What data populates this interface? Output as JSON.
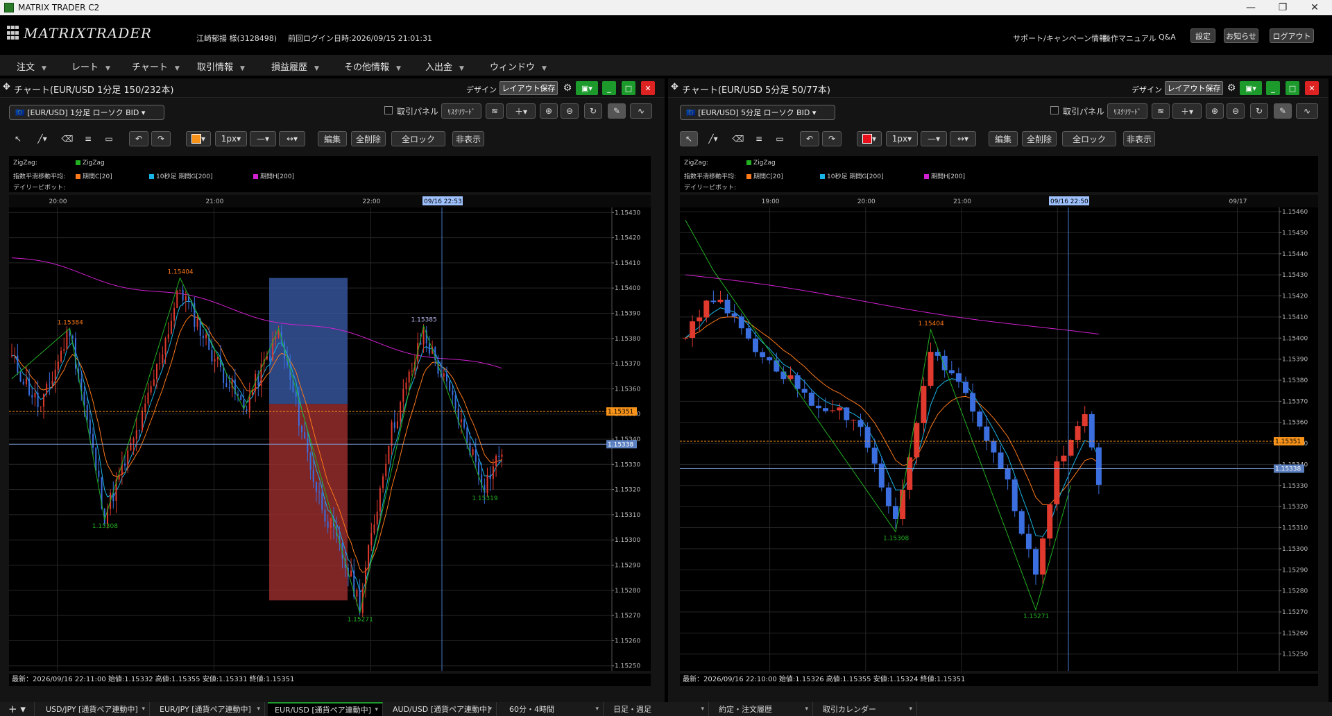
{
  "window": {
    "title": "MATRIX TRADER C2"
  },
  "header": {
    "logo": "MATRIXTRADER",
    "user": "江崎郁揚 様(3128498)",
    "last_login": "前回ログイン日時:2026/09/15 21:01:31",
    "support": "サポート/キャンペーン情報",
    "manual": "操作マニュアル",
    "qa": "Q&A",
    "settings": "設定",
    "notice": "お知らせ",
    "logout": "ログアウト"
  },
  "menu": [
    "注文",
    "レート",
    "チャート",
    "取引情報",
    "損益履歴",
    "その他情報",
    "入出金",
    "ウィンドウ"
  ],
  "colors": {
    "bull": "#e03a2e",
    "bear": "#3b6fe0",
    "ema20": "#ff7a1a",
    "ema10s": "#19b4e6",
    "ema200": "#d020d0",
    "zigzag": "#22b022",
    "accent": "#1c9b2c"
  },
  "panels": [
    {
      "title": "チャート(EUR/USD 1分足 150/232本)",
      "symbol": "[EUR/USD] 1分足 ローソク BID",
      "design": "デザイン",
      "save_layout": "レイアウト保存",
      "trade_panel": "取引パネル",
      "risk_reward": "ﾘｽｸﾘﾜｰﾄﾞ",
      "width_option": "1px",
      "edit": "編集",
      "delete_all": "全削除",
      "lock_all": "全ロック",
      "hide": "非表示",
      "legend": {
        "zigzag_label": "ZigZag:",
        "zigzag": "ZigZag",
        "ema_label": "指数平滑移動平均:",
        "ema1": "期間C[20]",
        "ema2": "10秒足 期間G[200]",
        "ema3": "期間H[200]",
        "pivot_label": "デイリーピボット:"
      },
      "time_labels": [
        {
          "t": "20:00",
          "f": 0.08
        },
        {
          "t": "21:00",
          "f": 0.34
        },
        {
          "t": "22:00",
          "f": 0.6
        }
      ],
      "cursor_time": "09/16 22:53",
      "price_ticks": [
        "1.15430",
        "1.15420",
        "1.15410",
        "1.15400",
        "1.15390",
        "1.15380",
        "1.15370",
        "1.15360",
        "1.15350",
        "1.15340",
        "1.15330",
        "1.15320",
        "1.15310",
        "1.15300",
        "1.15290",
        "1.15280",
        "1.15270",
        "1.15260",
        "1.15250"
      ],
      "price_range": [
        1.15248,
        1.15432
      ],
      "last_price": "1.15351",
      "line_price": "1.15338",
      "zigzag_labels": [
        {
          "text": "1.15384",
          "price": 1.15384,
          "i": 20,
          "color": "#ff7a1a"
        },
        {
          "text": "1.15404",
          "price": 1.15404,
          "i": 58,
          "color": "#ff7a1a"
        },
        {
          "text": "1.15308",
          "price": 1.15308,
          "i": 32,
          "color": "#22b022"
        },
        {
          "text": "1.15385",
          "price": 1.15385,
          "i": 142,
          "color": "#b9b9f0"
        },
        {
          "text": "1.15271",
          "price": 1.15271,
          "i": 120,
          "color": "#22b022"
        },
        {
          "text": "1.15319",
          "price": 1.15319,
          "i": 163,
          "color": "#22b022"
        }
      ],
      "status": "最新：2026/09/16 22:11:00 始値:1.15332 高値:1.15355 安値:1.15331 終値:1.15351"
    },
    {
      "title": "チャート(EUR/USD 5分足 50/77本)",
      "symbol": "[EUR/USD] 5分足 ローソク BID",
      "design": "デザイン",
      "save_layout": "レイアウト保存",
      "trade_panel": "取引パネル",
      "risk_reward": "ﾘｽｸﾘﾜｰﾄﾞ",
      "width_option": "1px",
      "edit": "編集",
      "delete_all": "全削除",
      "lock_all": "全ロック",
      "hide": "非表示",
      "legend": {
        "zigzag_label": "ZigZag:",
        "zigzag": "ZigZag",
        "ema_label": "指数平滑移動平均:",
        "ema1": "期間C[20]",
        "ema2": "10秒足 期間G[200]",
        "ema3": "期間H[200]",
        "pivot_label": "デイリーピボット:"
      },
      "time_labels": [
        {
          "t": "19:00",
          "f": 0.15
        },
        {
          "t": "20:00",
          "f": 0.31
        },
        {
          "t": "21:00",
          "f": 0.47
        },
        {
          "t": "22:00",
          "f": 0.63
        },
        {
          "t": "09/17",
          "f": 0.93
        }
      ],
      "cursor_time": "09/16 22:50",
      "price_ticks": [
        "1.15460",
        "1.15450",
        "1.15440",
        "1.15430",
        "1.15420",
        "1.15410",
        "1.15400",
        "1.15390",
        "1.15380",
        "1.15370",
        "1.15360",
        "1.15350",
        "1.15340",
        "1.15330",
        "1.15320",
        "1.15310",
        "1.15300",
        "1.15290",
        "1.15280",
        "1.15270",
        "1.15260",
        "1.15250"
      ],
      "price_range": [
        1.15242,
        1.15462
      ],
      "last_price": "1.15351",
      "line_price": "1.15338",
      "zigzag_labels": [
        {
          "text": "1.15404",
          "price": 1.15404,
          "i": 35,
          "color": "#ff7a1a"
        },
        {
          "text": "1.15308",
          "price": 1.15308,
          "i": 30,
          "color": "#22b022"
        },
        {
          "text": "1.15271",
          "price": 1.15271,
          "i": 50,
          "color": "#22b022"
        }
      ],
      "status": "最新：2026/09/16 22:10:00 始値:1.15326 高値:1.15355 安値:1.15324 終値:1.15351"
    }
  ],
  "tabs": [
    "USD/JPY [通貨ペア連動中]",
    "EUR/JPY [通貨ペア連動中]",
    "EUR/USD [通貨ペア連動中]",
    "AUD/USD [通貨ペア連動中]",
    "60分・4時間",
    "日足・週足",
    "約定・注文履歴",
    "取引カレンダー"
  ]
}
